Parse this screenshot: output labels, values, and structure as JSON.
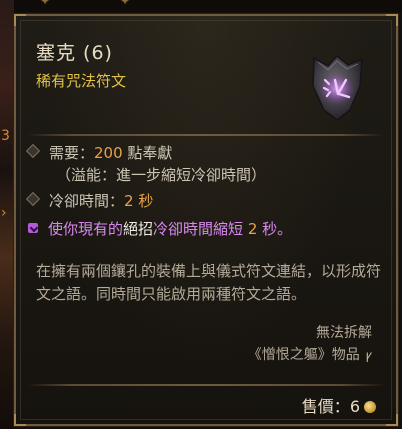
{
  "item": {
    "name": "塞克 (6)",
    "type": "稀有咒法符文",
    "rune_icon": "purple-rune-stone-icon",
    "requirement_label": "需要：",
    "requirement_value": "200",
    "requirement_unit": " 點奉獻",
    "overflow_note": "（溢能：進一步縮短冷卻時間）",
    "cooldown_label": "冷卻時間：",
    "cooldown_value": "2 秒",
    "effect_part1": "使你現有的",
    "effect_keyword": "絕招",
    "effect_part2": "冷卻時間縮短 ",
    "effect_value": "2",
    "effect_part3": " 秒。",
    "flavor_text": "在擁有兩個鑲孔的裝備上與儀式符文連結，以形成符文之語。同時間只能啟用兩種符文之語。",
    "unsalvageable": "無法拆解",
    "expansion": "《憎恨之軀》物品",
    "expansion_icon": "expansion-glyph-icon",
    "price_label": "售價：",
    "price_value": "6",
    "currency_icon": "gold-coin-icon"
  },
  "colors": {
    "title": "#e8dcc4",
    "rarity_yellow": "#e2c247",
    "requirement_orange": "#e7a24a",
    "legendary_purple": "#d88af0",
    "body_text": "#cdc4b4",
    "frame": "#6e5b40"
  }
}
